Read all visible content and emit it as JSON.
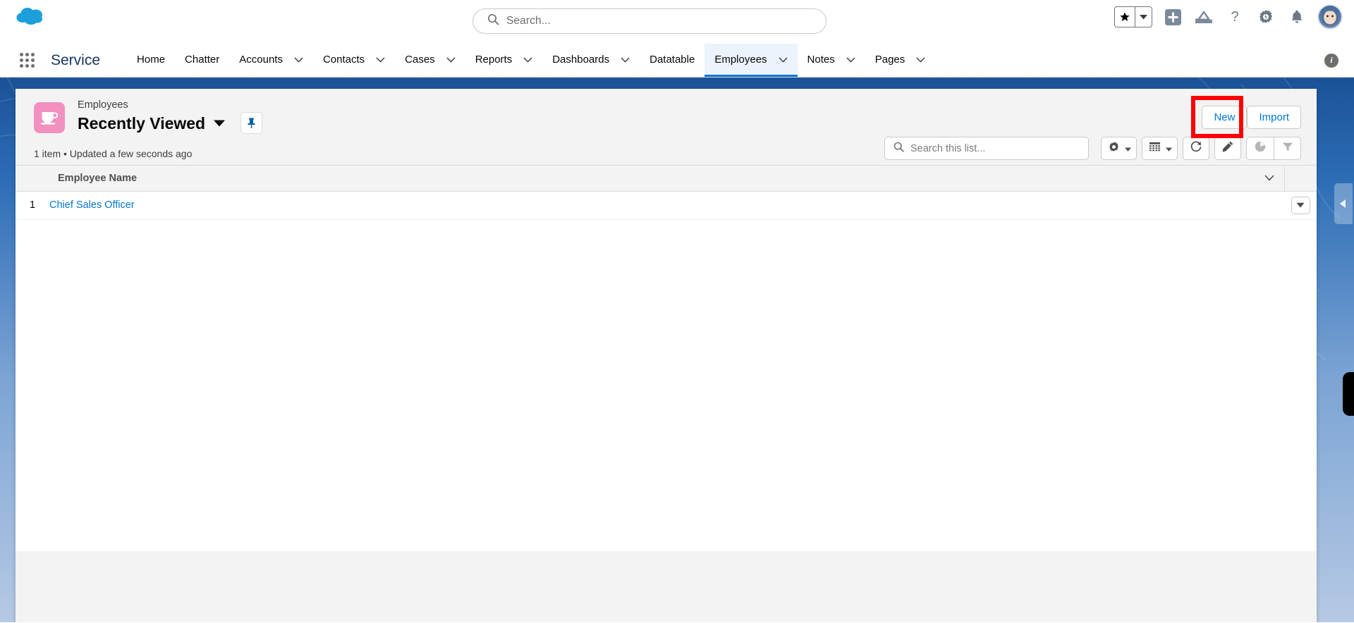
{
  "app": {
    "logo_icon": "salesforce-cloud-logo",
    "app_name": "Service"
  },
  "global_search": {
    "placeholder": "Search...",
    "icon": "search-icon"
  },
  "header_icons": [
    {
      "name": "favorites-star-icon",
      "glyph": "★"
    },
    {
      "name": "favorites-caret-icon",
      "glyph": "▾"
    },
    {
      "name": "add-icon",
      "glyph": "+"
    },
    {
      "name": "learning-icon",
      "glyph": "▲"
    },
    {
      "name": "help-icon",
      "glyph": "?"
    },
    {
      "name": "setup-gear-icon",
      "glyph": "⚙"
    },
    {
      "name": "notifications-bell-icon",
      "glyph": "🔔"
    },
    {
      "name": "user-avatar",
      "glyph": ""
    }
  ],
  "nav": {
    "items": [
      {
        "label": "Home",
        "has_caret": false,
        "active": false
      },
      {
        "label": "Chatter",
        "has_caret": false,
        "active": false
      },
      {
        "label": "Accounts",
        "has_caret": true,
        "active": false
      },
      {
        "label": "Contacts",
        "has_caret": true,
        "active": false
      },
      {
        "label": "Cases",
        "has_caret": true,
        "active": false
      },
      {
        "label": "Reports",
        "has_caret": true,
        "active": false
      },
      {
        "label": "Dashboards",
        "has_caret": true,
        "active": false
      },
      {
        "label": "Datatable",
        "has_caret": false,
        "active": false
      },
      {
        "label": "Employees",
        "has_caret": true,
        "active": true
      },
      {
        "label": "Notes",
        "has_caret": true,
        "active": false
      },
      {
        "label": "Pages",
        "has_caret": true,
        "active": false
      }
    ],
    "info_icon": "info-icon",
    "info_glyph": "i"
  },
  "list_header": {
    "object_icon": "coffee-cup-object-icon",
    "eyebrow": "Employees",
    "title": "Recently Viewed",
    "title_caret_icon": "chevron-down-icon",
    "pin_icon": "pin-icon",
    "meta": "1 item • Updated a few seconds ago"
  },
  "actions": {
    "new_label": "New",
    "import_label": "Import",
    "highlight_color": "#ff0000"
  },
  "toolbar": {
    "search_placeholder": "Search this list...",
    "search_icon": "search-icon",
    "buttons": [
      {
        "name": "list-view-controls-button",
        "icon": "gear-icon",
        "disabled": false
      },
      {
        "name": "display-as-button",
        "icon": "table-icon",
        "disabled": false
      },
      {
        "name": "refresh-button",
        "icon": "refresh-icon",
        "disabled": false
      },
      {
        "name": "edit-button",
        "icon": "pencil-icon",
        "disabled": false
      },
      {
        "name": "charts-button",
        "icon": "pie-chart-icon",
        "disabled": true
      },
      {
        "name": "filter-button",
        "icon": "funnel-icon",
        "disabled": true
      }
    ]
  },
  "table": {
    "columns": [
      "",
      "Employee Name",
      "",
      ""
    ],
    "name_column_header": "Employee Name",
    "column_chevron_icon": "chevron-down-icon",
    "rows": [
      {
        "num": "1",
        "employee_name": "Chief Sales Officer",
        "action_icon": "row-actions-triangle-icon"
      }
    ]
  },
  "rail": {
    "collapse_icon": "collapse-left-arrow-icon"
  },
  "colors": {
    "brand_blue": "#0176d3",
    "link_blue": "#0176d3",
    "object_pink": "#f291c0",
    "banner_blue": "#1b5297",
    "highlight_red": "#ff0000"
  }
}
